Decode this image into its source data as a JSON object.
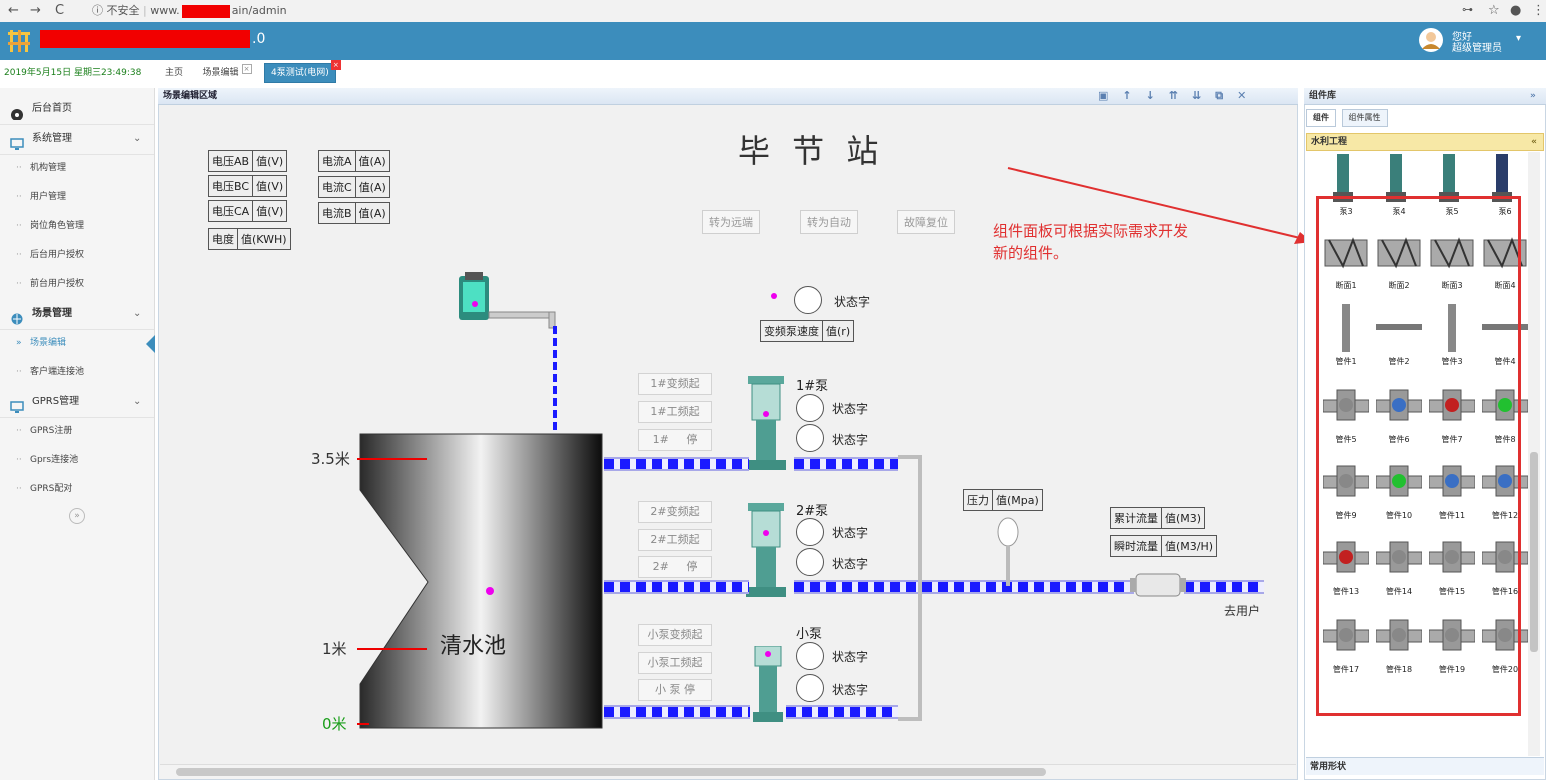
{
  "browser": {
    "nav_back": "←",
    "nav_forward": "→",
    "nav_reload": "C",
    "insecure_label": "ⓘ 不安全",
    "url_prefix": "www.",
    "url_suffix": "ain/admin",
    "icons": [
      "key-icon",
      "star-icon",
      "account-icon",
      "menu-icon"
    ]
  },
  "header": {
    "title_suffix": ".0",
    "user_greeting": "您好",
    "user_role": "超级管理员"
  },
  "datetime": "2019年5月15日 星期三23:49:38",
  "tabs": [
    {
      "label": "主页",
      "closable": false,
      "active": false
    },
    {
      "label": "场景编辑",
      "closable": true,
      "active": false
    },
    {
      "label": "4泵测试(电网)",
      "closable": true,
      "active": true
    }
  ],
  "sidebar": {
    "items": [
      {
        "type": "top",
        "label": "后台首页",
        "icon": "dashboard-icon"
      },
      {
        "type": "group",
        "label": "系统管理",
        "icon": "monitor-icon"
      },
      {
        "type": "sub",
        "label": "机构管理"
      },
      {
        "type": "sub",
        "label": "用户管理"
      },
      {
        "type": "sub",
        "label": "岗位角色管理"
      },
      {
        "type": "sub",
        "label": "后台用户授权"
      },
      {
        "type": "sub",
        "label": "前台用户授权"
      },
      {
        "type": "group",
        "label": "场景管理",
        "icon": "globe-icon",
        "bold": true
      },
      {
        "type": "sub",
        "label": "场景编辑",
        "active": true
      },
      {
        "type": "sub",
        "label": "客户端连接池"
      },
      {
        "type": "group",
        "label": "GPRS管理",
        "icon": "monitor-icon"
      },
      {
        "type": "sub",
        "label": "GPRS注册"
      },
      {
        "type": "sub",
        "label": "Gprs连接池"
      },
      {
        "type": "sub",
        "label": "GPRS配对"
      }
    ]
  },
  "editor": {
    "title": "场景编辑区域",
    "toolbar_icons": [
      "save-icon",
      "arrow-up-icon",
      "arrow-down-icon",
      "double-up-icon",
      "double-down-icon",
      "copy-icon",
      "delete-icon"
    ]
  },
  "scene": {
    "station_title": "毕 节 站",
    "readouts_left": [
      [
        "电压AB",
        "值(V)"
      ],
      [
        "电压BC",
        "值(V)"
      ],
      [
        "电压CA",
        "值(V)"
      ],
      [
        "电度",
        "值(KWH)"
      ]
    ],
    "readouts_current": [
      [
        "电流A",
        "值(A)"
      ],
      [
        "电流C",
        "值(A)"
      ],
      [
        "电流B",
        "值(A)"
      ]
    ],
    "mode_buttons": [
      "转为远端",
      "转为自动",
      "故障复位"
    ],
    "annotation_line1": "组件面板可根据实际需求开发",
    "annotation_line2": "新的组件。",
    "state_word": "状态字",
    "vfd_speed": [
      "变频泵速度",
      "值(r)"
    ],
    "pumps": [
      {
        "name": "1#泵",
        "buttons": [
          "1#变频起",
          "1#工频起",
          "1#     停"
        ]
      },
      {
        "name": "2#泵",
        "buttons": [
          "2#变频起",
          "2#工频起",
          "2#     停"
        ]
      },
      {
        "name": "小泵",
        "buttons": [
          "小泵变频起",
          "小泵工频起",
          "小 泵 停"
        ]
      }
    ],
    "pressure": [
      "压力",
      "值(Mpa)"
    ],
    "flow_total": [
      "累计流量",
      "值(M3)"
    ],
    "flow_instant": [
      "瞬时流量",
      "值(M3/H)"
    ],
    "to_user": "去用户",
    "tank_label": "清水池",
    "levels": {
      "high": "3.5米",
      "low": "1米",
      "zero": "0米"
    },
    "colors": {
      "pipe": "#1a1aff",
      "level_zero": "#1a9e1a",
      "annotation": "#e03030"
    }
  },
  "component_panel": {
    "title": "组件库",
    "tabs": [
      "组件",
      "组件属性"
    ],
    "section": "水利工程",
    "section_bottom": "常用形状",
    "items": [
      "泵3",
      "泵4",
      "泵5",
      "泵6",
      "断面1",
      "断面2",
      "断面3",
      "断面4",
      "管件1",
      "管件2",
      "管件3",
      "管件4",
      "管件5",
      "管件6",
      "管件7",
      "管件8",
      "管件9",
      "管件10",
      "管件11",
      "管件12",
      "管件13",
      "管件14",
      "管件15",
      "管件16",
      "管件17",
      "管件18",
      "管件19",
      "管件20"
    ]
  }
}
